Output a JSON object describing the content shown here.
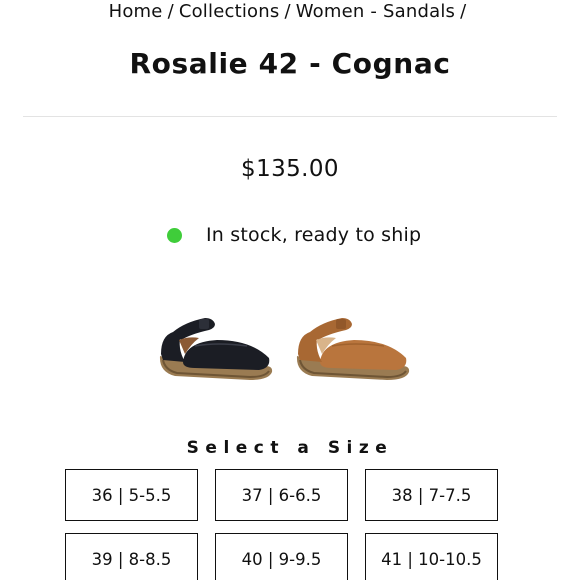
{
  "breadcrumb": {
    "items": [
      "Home",
      "Collections",
      "Women - Sandals"
    ],
    "separator": "/"
  },
  "product": {
    "title": "Rosalie 42 - Cognac",
    "price": "$135.00",
    "stock_text": "In stock, ready to ship",
    "stock_color": "#3fcd3a"
  },
  "swatches": [
    {
      "name": "Black",
      "color": "#1b1d24"
    },
    {
      "name": "Cognac",
      "color": "#b9753d"
    }
  ],
  "size_selector": {
    "heading": "Select a Size",
    "sizes": [
      "36 | 5-5.5",
      "37 | 6-6.5",
      "38 | 7-7.5",
      "39 | 8-8.5",
      "40 | 9-9.5",
      "41 | 10-10.5"
    ]
  }
}
